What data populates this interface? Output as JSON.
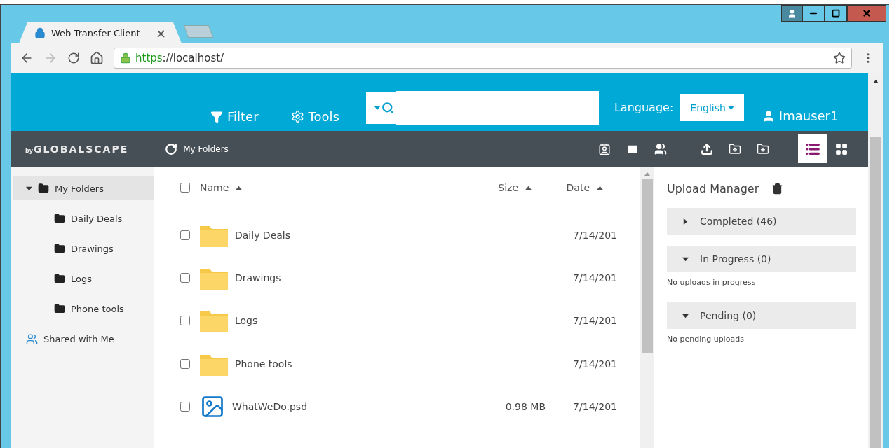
{
  "browser": {
    "tab": {
      "title": "Web Transfer Client",
      "close": "×",
      "selected": true
    },
    "url": {
      "scheme": "https",
      "rest": "://localhost/"
    }
  },
  "header": {
    "filter": "Filter",
    "tools": "Tools",
    "language_label": "Language:",
    "language": "English",
    "user": "Imauser1"
  },
  "toolbar": {
    "brand_by": "by",
    "brand": "GLOBALSCAPE",
    "location": "My Folders",
    "views": [
      {
        "kind": "list",
        "selected": true
      },
      {
        "kind": "grid",
        "selected": false
      }
    ]
  },
  "tree": [
    {
      "label": "My Folders",
      "kind": "folder",
      "expanded": true,
      "selected": true,
      "children": [
        {
          "label": "Daily Deals",
          "kind": "folder",
          "selected": false
        },
        {
          "label": "Drawings",
          "kind": "folder",
          "selected": false
        },
        {
          "label": "Logs",
          "kind": "folder",
          "selected": false
        },
        {
          "label": "Phone tools",
          "kind": "folder",
          "selected": false
        }
      ]
    },
    {
      "label": "Shared with Me",
      "kind": "shared",
      "selected": false
    }
  ],
  "table": {
    "select_all": {
      "checked": false
    },
    "columns": [
      "Name",
      "Size",
      "Date"
    ],
    "rows": [
      {
        "kind": "folder",
        "name": "Daily Deals",
        "date": "7/14/201",
        "checked": false
      },
      {
        "kind": "folder",
        "name": "Drawings",
        "date": "7/14/201",
        "checked": false
      },
      {
        "kind": "folder",
        "name": "Logs",
        "date": "7/14/201",
        "checked": false
      },
      {
        "kind": "folder",
        "name": "Phone tools",
        "date": "7/14/201",
        "checked": false
      },
      {
        "kind": "image",
        "name": "WhatWeDo.psd",
        "size": "0.98 MB",
        "date": "7/14/201",
        "checked": false
      }
    ]
  },
  "upload_manager": {
    "title": "Upload Manager",
    "sections": [
      {
        "label": "Completed (46)",
        "expanded": false
      },
      {
        "label": "In Progress (0)",
        "expanded": true,
        "message": "No uploads in progress"
      },
      {
        "label": "Pending (0)",
        "expanded": true,
        "message": "No pending uploads"
      }
    ]
  }
}
